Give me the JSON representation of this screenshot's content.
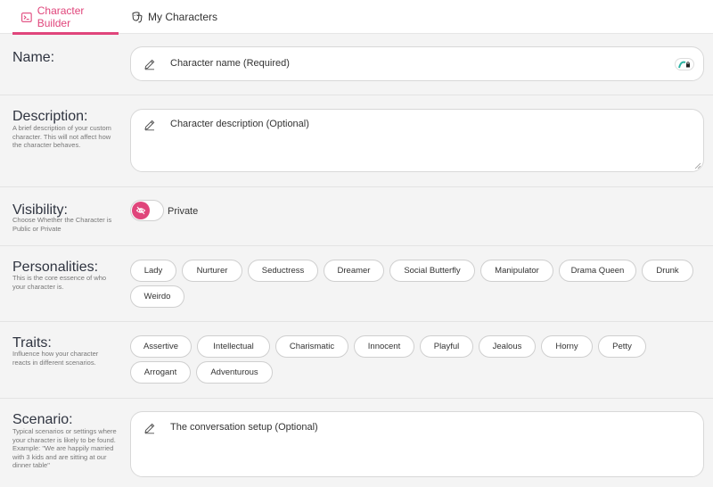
{
  "tabs": {
    "builder": {
      "label": "Character Builder",
      "icon": "terminal-icon",
      "active": true
    },
    "my_characters": {
      "label": "My Characters",
      "icon": "theater-masks-icon",
      "active": false
    }
  },
  "accent_color": "#e0457b",
  "name": {
    "title": "Name:",
    "placeholder": "Character name (Required)"
  },
  "description": {
    "title": "Description:",
    "help": "A brief description of your custom character. This will not affect how the character behaves.",
    "placeholder": "Character description (Optional)"
  },
  "visibility": {
    "title": "Visibility:",
    "help": "Choose Whether the Character is Public or Private",
    "value": "Private",
    "icon": "eye-off-icon"
  },
  "personalities": {
    "title": "Personalities:",
    "help": "This is the core essence of who your character is.",
    "options": [
      "Lady",
      "Nurturer",
      "Seductress",
      "Dreamer",
      "Social Butterfly",
      "Manipulator",
      "Drama Queen",
      "Drunk",
      "Weirdo"
    ]
  },
  "traits": {
    "title": "Traits:",
    "help": "Influence how your character reacts in different scenarios.",
    "options": [
      "Assertive",
      "Intellectual",
      "Charismatic",
      "Innocent",
      "Playful",
      "Jealous",
      "Horny",
      "Petty",
      "Arrogant",
      "Adventurous"
    ]
  },
  "scenario": {
    "title": "Scenario:",
    "help": "Typical scenarios or settings where your character is likely to be found. Example: \"We are happily married with 3 kids and are sitting at our dinner table\"",
    "placeholder": "The conversation setup (Optional)"
  }
}
